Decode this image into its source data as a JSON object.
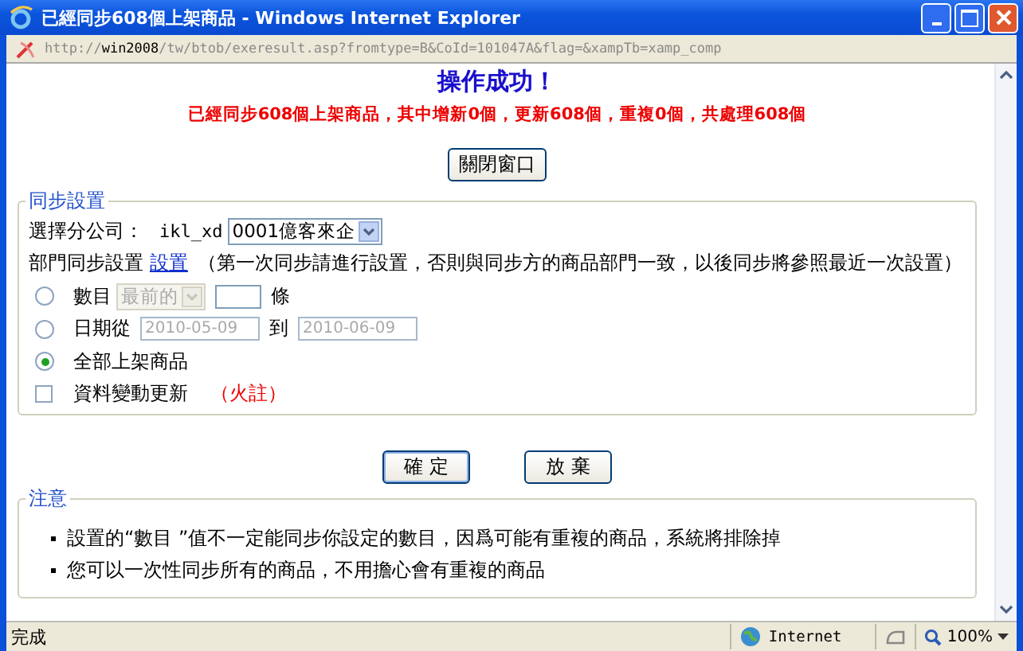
{
  "window": {
    "title": "已經同步608個上架商品 - Windows Internet Explorer"
  },
  "address_bar": {
    "scheme": "http://",
    "host": "win2008",
    "path": "/tw/btob/exeresult.asp?fromtype=B&CoId=101047A&flag=&xampTb=xamp_comp"
  },
  "page": {
    "heading": "操作成功！",
    "summary": "已經同步608個上架商品，其中增新0個，更新608個，重複0個，共處理608個",
    "close_button": "關閉窗口",
    "sync_settings": {
      "legend": "同步設置",
      "branch_label": "選擇分公司：",
      "branch_user": "ikl_xd",
      "branch_select": "0001億客來企",
      "dept_label": "部門同步設置",
      "dept_link": "設置",
      "dept_note": "（第一次同步請進行設置，否則與同步方的商品部門一致，以後同步將參照最近一次設置）",
      "options": [
        {
          "kind": "count",
          "label": "數目",
          "select": "最前的",
          "suffix": "條",
          "selected": false,
          "disabled": true
        },
        {
          "kind": "date",
          "label": "日期從",
          "from": "2010-05-09",
          "to_label": "到",
          "to": "2010-06-09",
          "selected": false,
          "disabled": true
        },
        {
          "kind": "all",
          "label": "全部上架商品",
          "selected": true
        }
      ],
      "update": {
        "label": "資料變動更新",
        "note": "（火註）",
        "checked": false
      }
    },
    "buttons": [
      "確 定",
      "放 棄"
    ],
    "notes": {
      "legend": "注意",
      "items": [
        "設置的“數目 ”值不一定能同步你設定的數目，因爲可能有重複的商品，系統將排除掉",
        "您可以一次性同步所有的商品，不用擔心會有重複的商品"
      ]
    }
  },
  "status_bar": {
    "text": "完成",
    "zone": "Internet",
    "zoom": "100%"
  }
}
